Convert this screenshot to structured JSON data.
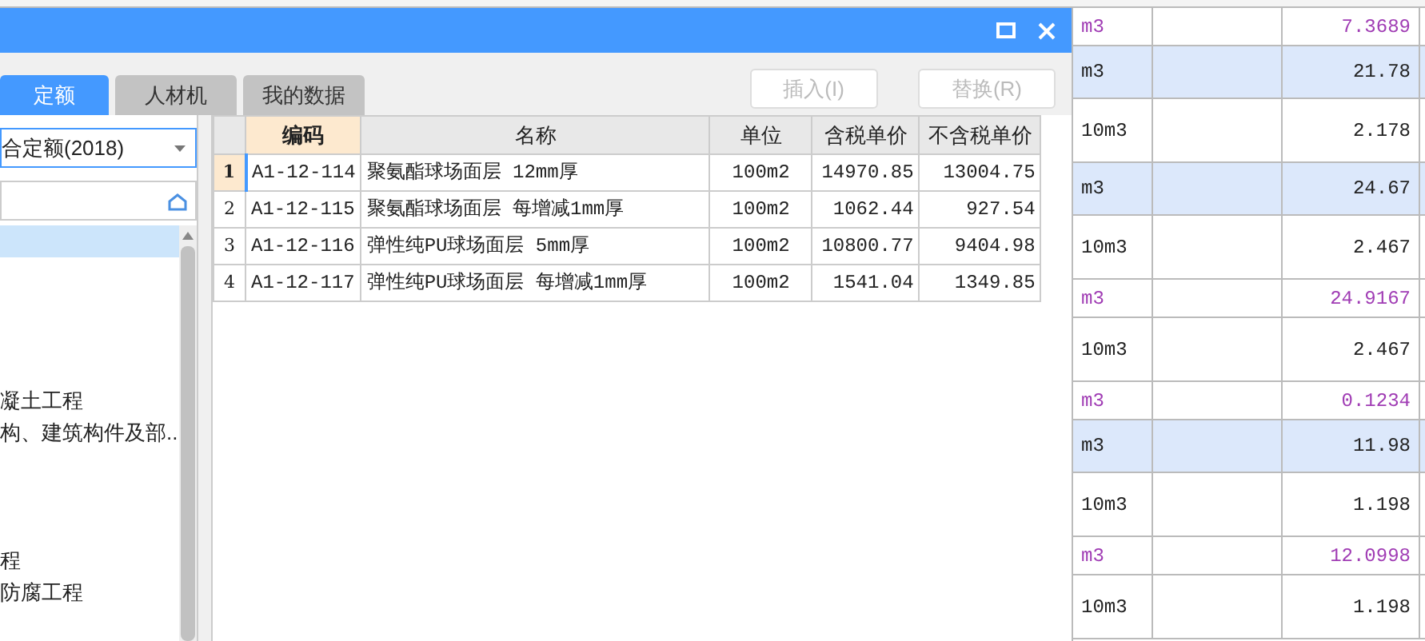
{
  "dialog": {
    "tabs": [
      {
        "label": "定额",
        "selected": true
      },
      {
        "label": "人材机",
        "selected": false
      },
      {
        "label": "我的数据",
        "selected": false
      }
    ],
    "buttons": [
      {
        "label": "插入(I)",
        "disabled": true
      },
      {
        "label": "替换(R)",
        "disabled": true
      }
    ],
    "library_select": {
      "value": "合定额(2018)"
    },
    "tree": {
      "items": [
        {
          "selected": true
        },
        {
          "selected": false
        },
        {
          "selected": false
        },
        {
          "selected": false
        },
        {
          "selected": false
        },
        {
          "label": "凝土工程",
          "selected": false
        },
        {
          "label": "构、建筑构件及部...",
          "selected": false
        },
        {
          "selected": false
        },
        {
          "selected": false
        },
        {
          "selected": false
        },
        {
          "label": "程",
          "selected": false
        },
        {
          "label": "防腐工程",
          "selected": false
        }
      ]
    },
    "table": {
      "columns": [
        {
          "label": "编码",
          "selected": true
        },
        {
          "label": "名称",
          "selected": false
        },
        {
          "label": "单位",
          "selected": false
        },
        {
          "label": "含税单价",
          "selected": false
        },
        {
          "label": "不含税单价",
          "selected": false
        }
      ],
      "rows": [
        {
          "number": "1",
          "selected": true,
          "cells": [
            "A1-12-114",
            "聚氨酯球场面层 12mm厚",
            "100m2",
            "14970.85",
            "13004.75"
          ]
        },
        {
          "number": "2",
          "selected": false,
          "cells": [
            "A1-12-115",
            "聚氨酯球场面层 每增减1mm厚",
            "100m2",
            "1062.44",
            "927.54"
          ]
        },
        {
          "number": "3",
          "selected": false,
          "cells": [
            "A1-12-116",
            "弹性纯PU球场面层 5mm厚",
            "100m2",
            "10800.77",
            "9404.98"
          ]
        },
        {
          "number": "4",
          "selected": false,
          "cells": [
            "A1-12-117",
            "弹性纯PU球场面层 每增减1mm厚",
            "100m2",
            "1541.04",
            "1349.85"
          ]
        }
      ]
    }
  },
  "background_table": {
    "rows": [
      {
        "kind": "material",
        "unit": "m3",
        "value": "7.3689"
      },
      {
        "kind": "quota",
        "unit": "m3",
        "value": "21.78"
      },
      {
        "kind": "detail",
        "unit": "10m3",
        "value": "2.178"
      },
      {
        "kind": "quota",
        "unit": "m3",
        "value": "24.67"
      },
      {
        "kind": "detail",
        "unit": "10m3",
        "value": "2.467"
      },
      {
        "kind": "material",
        "unit": "m3",
        "value": "24.9167"
      },
      {
        "kind": "detail",
        "unit": "10m3",
        "value": "2.467"
      },
      {
        "kind": "material",
        "unit": "m3",
        "value": "0.1234"
      },
      {
        "kind": "quota",
        "unit": "m3",
        "value": "11.98"
      },
      {
        "kind": "detail",
        "unit": "10m3",
        "value": "1.198"
      },
      {
        "kind": "material",
        "unit": "m3",
        "value": "12.0998"
      },
      {
        "kind": "detail",
        "unit": "10m3",
        "value": "1.198"
      }
    ]
  }
}
